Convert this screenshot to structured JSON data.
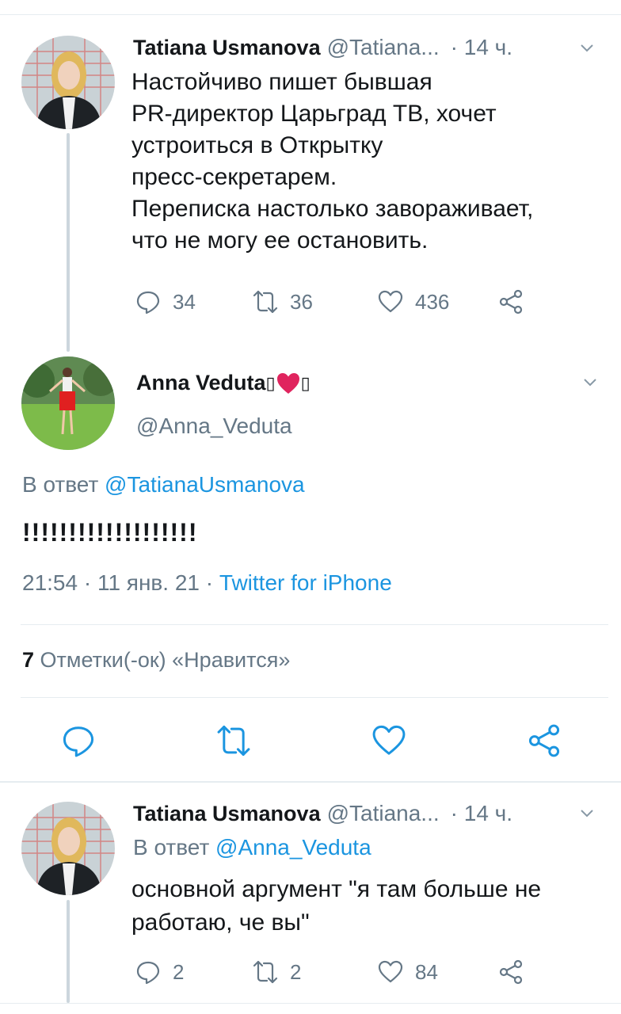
{
  "colors": {
    "accent": "#1b95e0",
    "muted": "#657786",
    "text": "#14171a",
    "heart": "#e0245e"
  },
  "tweet1": {
    "name": "Tatiana Usmanova",
    "handle": "@Tatiana...",
    "time": "· 14 ч.",
    "lines": [
      "Настойчиво пишет бывшая",
      "PR-директор Царьград ТВ, хочет",
      "устроиться в Открытку",
      "пресс-секретарем.",
      "Переписка настолько завораживает,",
      "что не могу ее остановить."
    ],
    "replies": "34",
    "retweets": "36",
    "likes": "436"
  },
  "tweet2": {
    "name": "Anna Veduta",
    "name_suffix_1": "▯",
    "name_suffix_2": "▯",
    "handle": "@Anna_Veduta",
    "reply_prefix": "В ответ",
    "reply_to": "@TatianaUsmanova",
    "text": "!!!!!!!!!!!!!!!!!!!",
    "time_date": "21:54 · 11 янв. 21 · ",
    "source": "Twitter for iPhone",
    "likes_count": "7",
    "likes_label": "Отметки(-ок) «Нравится»"
  },
  "tweet3": {
    "name": "Tatiana Usmanova",
    "handle": "@Tatiana...",
    "time": "· 14 ч.",
    "reply_prefix": "В ответ",
    "reply_to": "@Anna_Veduta",
    "lines": [
      "основной аргумент \"я там больше не",
      "работаю, че вы\""
    ],
    "replies": "2",
    "retweets": "2",
    "likes": "84"
  }
}
